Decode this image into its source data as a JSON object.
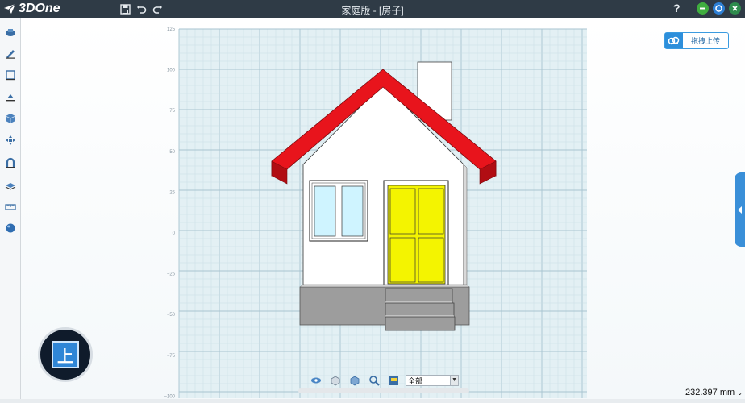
{
  "app": {
    "logo_text": "3DOne",
    "window_title": "家庭版 - [房子]",
    "help_label": "?"
  },
  "toolbar": {
    "items": [
      {
        "icon": "save-icon"
      },
      {
        "icon": "undo-icon"
      },
      {
        "icon": "redo-icon"
      }
    ]
  },
  "window_controls": [
    {
      "icon": "minimize-icon",
      "color": "#3fae3f"
    },
    {
      "icon": "settings-icon",
      "color": "#2d7fd4"
    },
    {
      "icon": "close-icon",
      "color": "#2e8b4d"
    }
  ],
  "upload": {
    "label": "拖拽上传",
    "icon": "cloud-upload-icon"
  },
  "sidebar": {
    "items": [
      {
        "icon": "basic-shapes-icon"
      },
      {
        "icon": "sketch-pencil-icon"
      },
      {
        "icon": "sketch-edit-icon"
      },
      {
        "icon": "special-function-icon"
      },
      {
        "icon": "feature-cube-icon"
      },
      {
        "icon": "basic-edit-icon"
      },
      {
        "icon": "combine-icon"
      },
      {
        "icon": "distance-icon"
      },
      {
        "icon": "measure-icon"
      },
      {
        "icon": "material-sphere-icon"
      }
    ]
  },
  "grid": {
    "y_labels": [
      "125",
      "100",
      "75",
      "50",
      "25",
      "0",
      "−25",
      "−50",
      "−75",
      "−100"
    ]
  },
  "view_cube": {
    "face_label": "上"
  },
  "view_tools": {
    "items": [
      {
        "icon": "view-eye-icon"
      },
      {
        "icon": "view-orient-icon"
      },
      {
        "icon": "render-mode-icon"
      },
      {
        "icon": "zoom-icon"
      },
      {
        "icon": "color-icon"
      }
    ],
    "filter_value": "全部"
  },
  "status": {
    "measurement": "232.397 mm"
  },
  "colors": {
    "roof": "#e8141c",
    "door": "#f4f400",
    "window_glass": "#cff4ff",
    "foundation": "#9d9d9d",
    "accent": "#2d8fdb"
  }
}
